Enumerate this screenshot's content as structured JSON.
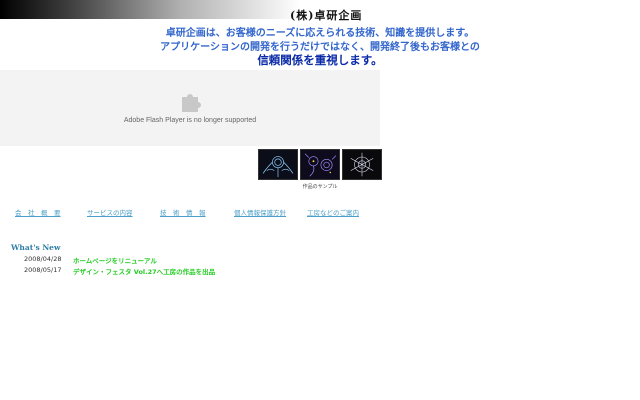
{
  "header": {
    "company_name": "(株)卓研企画"
  },
  "tagline": {
    "line1": "卓研企画は、お客様のニーズに応えられる技術、知識を提供します。",
    "line2": "アプリケーションの開発を行うだけではなく、開発終了後もお客様との",
    "line3": "信頼関係を重視します。"
  },
  "flash": {
    "message": "Adobe Flash Player is no longer supported",
    "icon": "puzzle-piece-icon"
  },
  "gallery": {
    "caption": "作品のサンプル"
  },
  "nav": {
    "items": [
      {
        "label": "会　社　概　要"
      },
      {
        "label": "サービスの内容"
      },
      {
        "label": "技　術　情　報"
      },
      {
        "label": "個人情報保護方針"
      },
      {
        "label": "工房などのご案内"
      }
    ]
  },
  "news": {
    "heading": "What's New",
    "items": [
      {
        "date": "2008/04/28",
        "title": "ホームページをリニューアル"
      },
      {
        "date": "2008/05/17",
        "title": "デザイン・フェスタ Vol.27へ工房の作品を出品"
      }
    ]
  },
  "colors": {
    "tagline_blue": "#3366cc",
    "tagline_emphasis": "#0a2aa8",
    "nav_link": "#4a9ec8",
    "news_link": "#22cc22",
    "whats_new": "#2e7da6"
  }
}
